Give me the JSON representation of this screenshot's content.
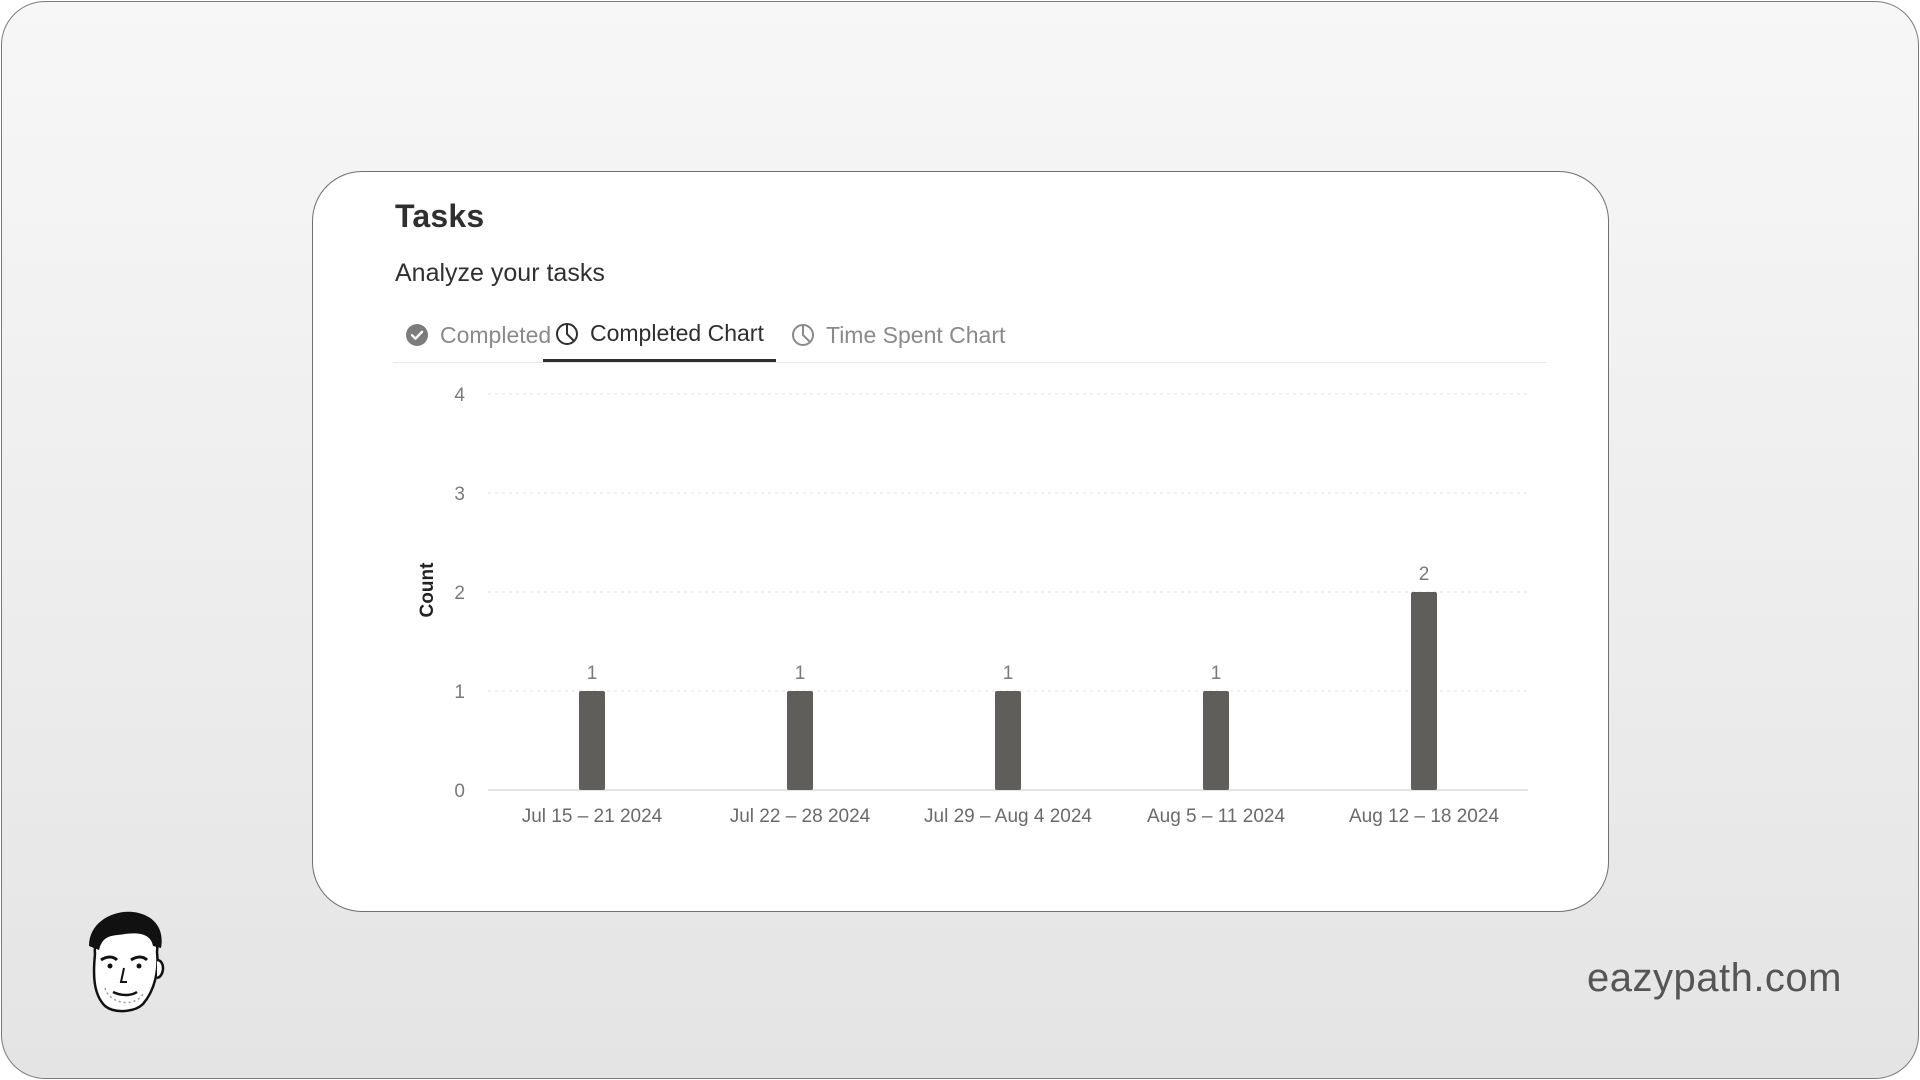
{
  "header": {
    "title": "Tasks",
    "subtitle": "Analyze your tasks"
  },
  "tabs": [
    {
      "label": "Completed",
      "icon": "check-circle-icon",
      "active": false
    },
    {
      "label": "Completed Chart",
      "icon": "pie-chart-icon",
      "active": true
    },
    {
      "label": "Time Spent Chart",
      "icon": "pie-chart-icon",
      "active": false
    }
  ],
  "footer": {
    "brand": "eazypath.com"
  },
  "colors": {
    "bar": "#5f5e5a",
    "grid": "#e3e3e3",
    "axis_text": "#7a7a7a"
  },
  "chart_data": {
    "type": "bar",
    "categories": [
      "Jul 15 – 21 2024",
      "Jul 22 – 28 2024",
      "Jul 29 – Aug 4 2024",
      "Aug 5 – 11 2024",
      "Aug 12 – 18 2024"
    ],
    "values": [
      1,
      1,
      1,
      1,
      2
    ],
    "data_labels": [
      "1",
      "1",
      "1",
      "1",
      "2"
    ],
    "title": "",
    "xlabel": "",
    "ylabel": "Count",
    "ylim": [
      0,
      4
    ],
    "yticks": [
      0,
      1,
      2,
      3,
      4
    ],
    "grid": true,
    "legend": "none"
  }
}
